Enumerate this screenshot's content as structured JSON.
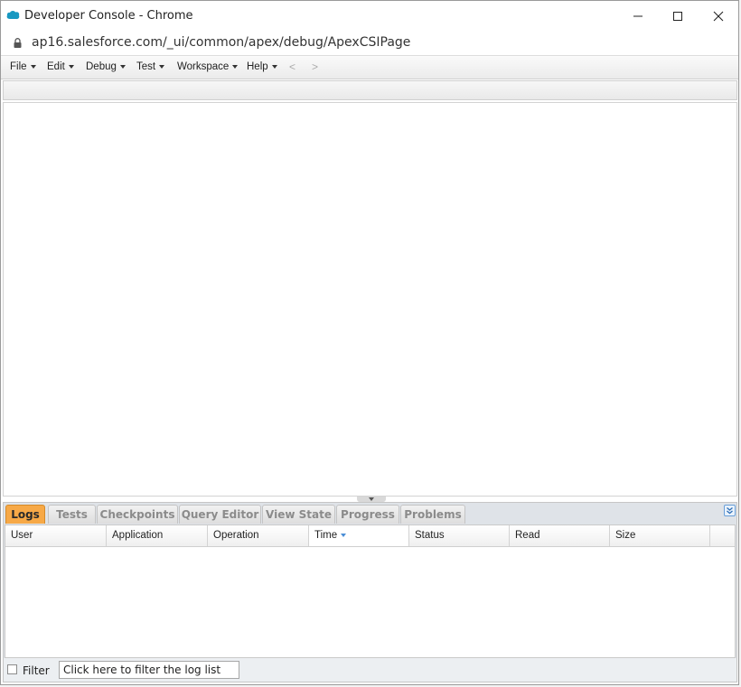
{
  "window": {
    "title": "Developer Console - Chrome"
  },
  "browser": {
    "url": "ap16.salesforce.com/_ui/common/apex/debug/ApexCSIPage"
  },
  "menu": {
    "items": [
      {
        "label": "File"
      },
      {
        "label": "Edit"
      },
      {
        "label": "Debug"
      },
      {
        "label": "Test"
      },
      {
        "label": "Workspace"
      },
      {
        "label": "Help"
      }
    ],
    "back": "<",
    "forward": ">"
  },
  "panel": {
    "tabs": [
      {
        "label": "Logs",
        "active": true
      },
      {
        "label": "Tests"
      },
      {
        "label": "Checkpoints"
      },
      {
        "label": "Query Editor"
      },
      {
        "label": "View State"
      },
      {
        "label": "Progress"
      },
      {
        "label": "Problems"
      }
    ],
    "columns": [
      "User",
      "Application",
      "Operation",
      "Time",
      "Status",
      "Read",
      "Size"
    ],
    "sorted_column": "Time",
    "rows": [],
    "filter": {
      "label": "Filter",
      "value": "Click here to filter the log list",
      "checked": false
    }
  },
  "colors": {
    "active_tab": "#f7a947",
    "sort_indicator": "#4a8ed6",
    "brand_cloud": "#1798c1"
  },
  "icons": [
    "salesforce-cloud-icon",
    "minimize-icon",
    "maximize-icon",
    "close-icon",
    "lock-icon",
    "collapse-panel-icon"
  ]
}
